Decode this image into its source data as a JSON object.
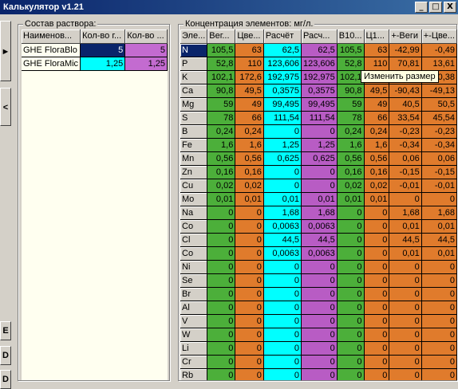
{
  "window": {
    "title": "Калькулятор v1.21",
    "buttons": [
      "_",
      "□",
      "X"
    ]
  },
  "side_buttons": [
    "►",
    "<",
    "E",
    "D",
    "D"
  ],
  "solution": {
    "legend": "Состав раствора:",
    "columns": [
      "Наименов...",
      "Кол-во г...",
      "Кол-во ..."
    ],
    "rows": [
      {
        "name": "GHE FloraBlo",
        "v1": "5",
        "v2": "5"
      },
      {
        "name": "GHE FloraMic",
        "v1": "1,25",
        "v2": "1,25"
      }
    ]
  },
  "concentration": {
    "legend": "Концентрация элементов: мг/л.",
    "columns": [
      "Эле...",
      "Вег...",
      "Цве...",
      "Расчёт",
      "Расч...",
      "В10...",
      "Ц1...",
      "+-Веги",
      "+-Цве..."
    ],
    "rows": [
      [
        "N",
        "105,5",
        "63",
        "62,5",
        "62,5",
        "105,5",
        "63",
        "-42,99",
        "-0,49"
      ],
      [
        "P",
        "52,8",
        "110",
        "123,606",
        "123,606",
        "52,8",
        "110",
        "70,81",
        "13,61"
      ],
      [
        "K",
        "102,1",
        "172,6",
        "192,975",
        "192,975",
        "102,1",
        "",
        "",
        "0,38"
      ],
      [
        "Ca",
        "90,8",
        "49,5",
        "0,3575",
        "0,3575",
        "90,8",
        "49,5",
        "-90,43",
        "-49,13"
      ],
      [
        "Mg",
        "59",
        "49",
        "99,495",
        "99,495",
        "59",
        "49",
        "40,5",
        "50,5"
      ],
      [
        "S",
        "78",
        "66",
        "111,54",
        "111,54",
        "78",
        "66",
        "33,54",
        "45,54"
      ],
      [
        "B",
        "0,24",
        "0,24",
        "0",
        "0",
        "0,24",
        "0,24",
        "-0,23",
        "-0,23"
      ],
      [
        "Fe",
        "1,6",
        "1,6",
        "1,25",
        "1,25",
        "1,6",
        "1,6",
        "-0,34",
        "-0,34"
      ],
      [
        "Mn",
        "0,56",
        "0,56",
        "0,625",
        "0,625",
        "0,56",
        "0,56",
        "0,06",
        "0,06"
      ],
      [
        "Zn",
        "0,16",
        "0,16",
        "0",
        "0",
        "0,16",
        "0,16",
        "-0,15",
        "-0,15"
      ],
      [
        "Cu",
        "0,02",
        "0,02",
        "0",
        "0",
        "0,02",
        "0,02",
        "-0,01",
        "-0,01"
      ],
      [
        "Mo",
        "0,01",
        "0,01",
        "0,01",
        "0,01",
        "0,01",
        "0,01",
        "0",
        "0"
      ],
      [
        "Na",
        "0",
        "0",
        "1,68",
        "1,68",
        "0",
        "0",
        "1,68",
        "1,68"
      ],
      [
        "Co",
        "0",
        "0",
        "0,0063",
        "0,0063",
        "0",
        "0",
        "0,01",
        "0,01"
      ],
      [
        "Cl",
        "0",
        "0",
        "44,5",
        "44,5",
        "0",
        "0",
        "44,5",
        "44,5"
      ],
      [
        "Co",
        "0",
        "0",
        "0,0063",
        "0,0063",
        "0",
        "0",
        "0,01",
        "0,01"
      ],
      [
        "Ni",
        "0",
        "0",
        "0",
        "0",
        "0",
        "0",
        "0",
        "0"
      ],
      [
        "Se",
        "0",
        "0",
        "0",
        "0",
        "0",
        "0",
        "0",
        "0"
      ],
      [
        "Br",
        "0",
        "0",
        "0",
        "0",
        "0",
        "0",
        "0",
        "0"
      ],
      [
        "Al",
        "0",
        "0",
        "0",
        "0",
        "0",
        "0",
        "0",
        "0"
      ],
      [
        "V",
        "0",
        "0",
        "0",
        "0",
        "0",
        "0",
        "0",
        "0"
      ],
      [
        "W",
        "0",
        "0",
        "0",
        "0",
        "0",
        "0",
        "0",
        "0"
      ],
      [
        "Li",
        "0",
        "0",
        "0",
        "0",
        "0",
        "0",
        "0",
        "0"
      ],
      [
        "Cr",
        "0",
        "0",
        "0",
        "0",
        "0",
        "0",
        "0",
        "0"
      ],
      [
        "Rb",
        "0",
        "0",
        "0",
        "0",
        "0",
        "0",
        "0",
        "0"
      ]
    ],
    "selected_row": 0,
    "tooltip": "Изменить размер"
  },
  "colors": {
    "navy": "#0a246a",
    "green": "#4caf3a",
    "orange": "#e07b2c",
    "cyan": "#00ffff",
    "magenta": "#b85cc4",
    "pink": "#c36bd0",
    "cream": "#fffff0"
  }
}
